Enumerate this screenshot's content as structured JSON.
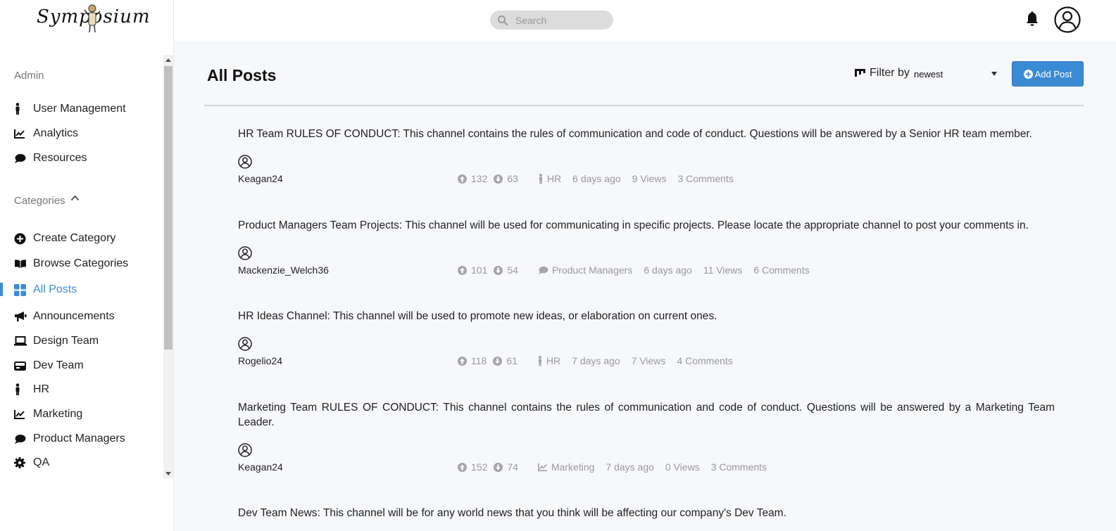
{
  "app": {
    "logo_text": "Symposium",
    "search_placeholder": "Search"
  },
  "icons": {
    "search": "search-icon",
    "bell": "bell-icon",
    "account": "user-circle-icon",
    "upvote": "arrow-up-circle-icon",
    "downvote": "arrow-down-circle-icon"
  },
  "colors": {
    "accent": "#3b8bd4",
    "muted_text": "#9a9a9a",
    "main_bg": "#f7f8fb"
  },
  "sidebar": {
    "admin_heading": "Admin",
    "admin_items": [
      {
        "label": "User Management",
        "icon": "person-icon"
      },
      {
        "label": "Analytics",
        "icon": "chart-line-icon"
      },
      {
        "label": "Resources",
        "icon": "speech-bubble-icon"
      }
    ],
    "categories_heading": "Categories",
    "categories_items": [
      {
        "label": "Create Category",
        "icon": "plus-circle-icon"
      },
      {
        "label": "Browse Categories",
        "icon": "open-book-icon"
      },
      {
        "label": "All Posts",
        "icon": "grid-icon",
        "active": true
      },
      {
        "label": "Announcements",
        "icon": "megaphone-icon"
      },
      {
        "label": "Design Team",
        "icon": "laptop-icon"
      },
      {
        "label": "Dev Team",
        "icon": "hard-drive-icon"
      },
      {
        "label": "HR",
        "icon": "person-icon"
      },
      {
        "label": "Marketing",
        "icon": "chart-line-icon"
      },
      {
        "label": "Product Managers",
        "icon": "speech-bubble-icon"
      },
      {
        "label": "QA",
        "icon": "gear-icon"
      }
    ]
  },
  "main": {
    "title": "All Posts",
    "filter_label": "Filter by",
    "filter_value": "newest",
    "add_post_label": "Add Post",
    "posts": [
      {
        "title": "HR Team RULES OF CONDUCT: This channel contains the rules of communication and code of conduct. Questions will be answered by a Senior HR team member.",
        "author": "Keagan24",
        "upvotes": "132",
        "downvotes": "63",
        "category": "HR",
        "category_icon": "person-icon",
        "time": "6 days ago",
        "views": "9 Views",
        "comments": "3 Comments"
      },
      {
        "title": "Product Managers Team Projects: This channel will be used for communicating in specific projects. Please locate the appropriate channel to post your comments in.",
        "author": "Mackenzie_Welch36",
        "upvotes": "101",
        "downvotes": "54",
        "category": "Product Managers",
        "category_icon": "speech-bubble-icon",
        "time": "6 days ago",
        "views": "11 Views",
        "comments": "6 Comments"
      },
      {
        "title": "HR Ideas Channel: This channel will be used to promote new ideas, or elaboration on current ones.",
        "author": "Rogelio24",
        "upvotes": "118",
        "downvotes": "61",
        "category": "HR",
        "category_icon": "person-icon",
        "time": "7 days ago",
        "views": "7 Views",
        "comments": "4 Comments"
      },
      {
        "title": "Marketing Team RULES OF CONDUCT: This channel contains the rules of communication and code of conduct. Questions will be answered by a Marketing Team Leader.",
        "author": "Keagan24",
        "upvotes": "152",
        "downvotes": "74",
        "category": "Marketing",
        "category_icon": "chart-line-icon",
        "time": "7 days ago",
        "views": "0 Views",
        "comments": "3 Comments"
      },
      {
        "title": "Dev Team News: This channel will be for any world news that you think will be affecting our company's Dev Team."
      }
    ]
  }
}
